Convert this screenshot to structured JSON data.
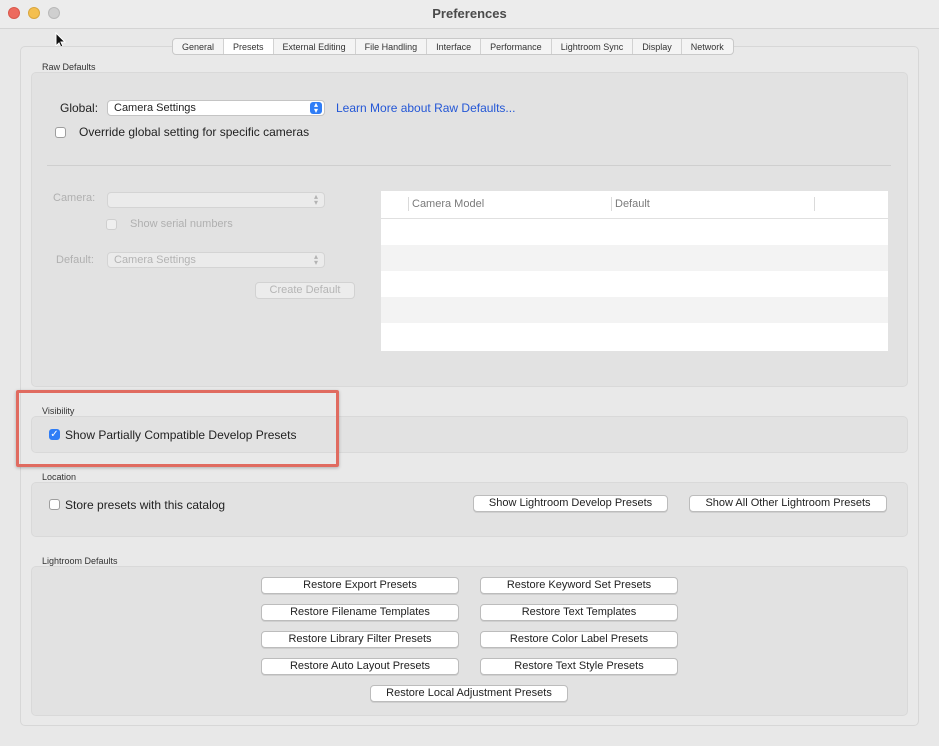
{
  "window": {
    "title": "Preferences"
  },
  "tabs": [
    "General",
    "Presets",
    "External Editing",
    "File Handling",
    "Interface",
    "Performance",
    "Lightroom Sync",
    "Display",
    "Network"
  ],
  "active_tab": "Presets",
  "raw_defaults": {
    "label": "Raw Defaults",
    "global_label": "Global:",
    "global_value": "Camera Settings",
    "learn_more": "Learn More about Raw Defaults...",
    "override_label": "Override global setting for specific cameras",
    "camera_label": "Camera:",
    "camera_value": "",
    "serial_label": "Show serial numbers",
    "default_label": "Default:",
    "default_value": "Camera Settings",
    "create_default": "Create Default",
    "table_headers": [
      "Camera Model",
      "Default"
    ]
  },
  "visibility": {
    "label": "Visibility",
    "show_partial_label": "Show Partially Compatible Develop Presets",
    "show_partial_checked": true
  },
  "location": {
    "label": "Location",
    "store_label": "Store presets with this catalog",
    "show_develop": "Show Lightroom Develop Presets",
    "show_other": "Show All Other Lightroom Presets"
  },
  "lightroom_defaults": {
    "label": "Lightroom Defaults",
    "buttons": [
      "Restore Export Presets",
      "Restore Keyword Set Presets",
      "Restore Filename Templates",
      "Restore Text Templates",
      "Restore Library Filter Presets",
      "Restore Color Label Presets",
      "Restore Auto Layout Presets",
      "Restore Text Style Presets",
      "Restore Local Adjustment Presets"
    ]
  },
  "colors": {
    "accent": "#2f7df6",
    "highlight": "#e06b60",
    "link": "#2457d6"
  }
}
